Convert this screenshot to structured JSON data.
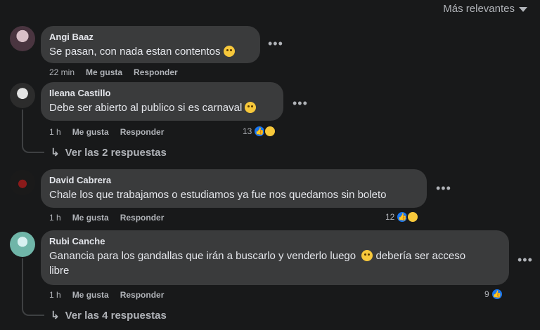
{
  "sort": {
    "label": "Más relevantes"
  },
  "comments": [
    {
      "name": "Angi Baaz",
      "text": "Se pasan, con nada estan contentos",
      "time": "22 min",
      "like": "Me gusta",
      "reply": "Responder",
      "reactions": ""
    },
    {
      "name": "Ileana Castillo",
      "text": "Debe ser abierto al publico si es carnaval",
      "time": "1 h",
      "like": "Me gusta",
      "reply": "Responder",
      "reactions": "13",
      "replies": "Ver las 2 respuestas"
    },
    {
      "name": "David Cabrera",
      "text": "Chale los que trabajamos o estudiamos ya fue nos quedamos sin boleto",
      "time": "1 h",
      "like": "Me gusta",
      "reply": "Responder",
      "reactions": "12"
    },
    {
      "name": "Rubi Canche",
      "text1": "Ganancia para los gandallas que irán a buscarlo y venderlo luego",
      "text2": "debería ser acceso",
      "text3": "libre",
      "time": "1 h",
      "like": "Me gusta",
      "reply": "Responder",
      "reactions": "9",
      "replies": "Ver las 4 respuestas"
    }
  ],
  "icons": {
    "more": "more-horizontal-icon",
    "like": "thumbs-up-icon",
    "haha": "haha-emoji-icon",
    "sad": "sad-emoji-icon",
    "reply_arrow": "reply-arrow-icon"
  }
}
